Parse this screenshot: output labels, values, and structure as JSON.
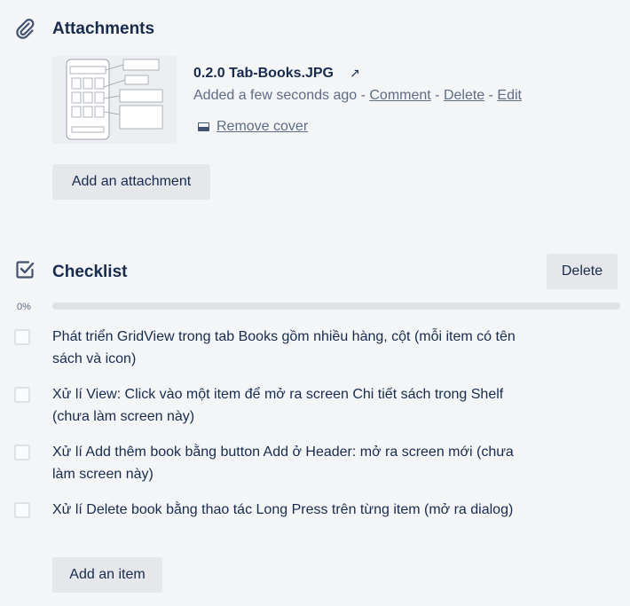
{
  "attachments": {
    "title": "Attachments",
    "icon": "paperclip-icon",
    "items": [
      {
        "name": "0.2.0 Tab-Books.JPG",
        "added": "Added a few seconds ago",
        "sep": " - ",
        "comment": "Comment",
        "delete": "Delete",
        "edit": "Edit",
        "remove_cover": "Remove cover"
      }
    ],
    "add_label": "Add an attachment"
  },
  "checklist": {
    "title": "Checklist",
    "icon": "checkbox-checked-icon",
    "delete_label": "Delete",
    "progress_label": "0%",
    "progress_fraction": 0,
    "accent": "#5aac44",
    "items": [
      {
        "text": "Phát triển GridView trong tab Books gồm nhiều hàng, cột (mỗi item có tên sách và icon)",
        "checked": false
      },
      {
        "text": "Xử lí View: Click vào một item để mở ra screen Chi tiết sách trong Shelf (chưa làm screen này)",
        "checked": false
      },
      {
        "text": "Xử lí Add thêm book bằng button Add ở Header: mở ra screen mới (chưa làm screen này)",
        "checked": false
      },
      {
        "text": "Xử lí Delete book bằng thao tác Long Press trên từng item (mở ra dialog)",
        "checked": false
      }
    ],
    "add_label": "Add an item"
  }
}
